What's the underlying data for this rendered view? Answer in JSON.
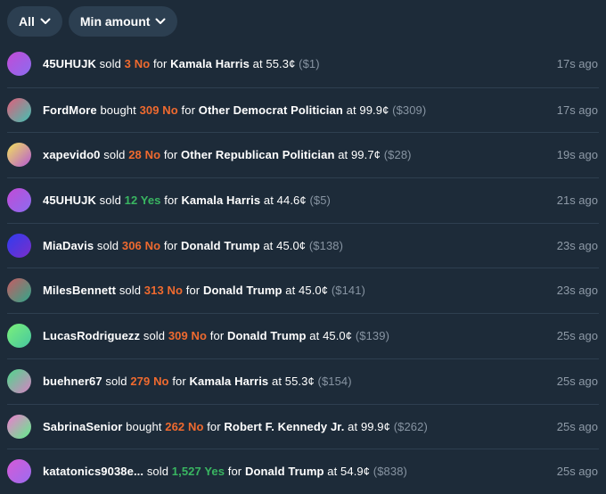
{
  "filters": {
    "all_label": "All",
    "min_amount_label": "Min amount"
  },
  "trades": [
    {
      "user": "45UHUJK",
      "verb": "sold",
      "amount": "3",
      "outcome": "No",
      "outcome_color": "#ef6a2f",
      "market": "Kamala Harris",
      "price": "55.3¢",
      "usd": "($1)",
      "time": "17s ago",
      "avatar_colors": [
        "#c24bd6",
        "#8a6cf0"
      ]
    },
    {
      "user": "FordMore",
      "verb": "bought",
      "amount": "309",
      "outcome": "No",
      "outcome_color": "#ef6a2f",
      "market": "Other Democrat Politician",
      "price": "99.9¢",
      "usd": "($309)",
      "time": "17s ago",
      "avatar_colors": [
        "#e35d7a",
        "#3fc2b3"
      ]
    },
    {
      "user": "xapevido0",
      "verb": "sold",
      "amount": "28",
      "outcome": "No",
      "outcome_color": "#ef6a2f",
      "market": "Other Republican Politician",
      "price": "99.7¢",
      "usd": "($28)",
      "time": "19s ago",
      "avatar_colors": [
        "#f2e35b",
        "#b65ad3"
      ]
    },
    {
      "user": "45UHUJK",
      "verb": "sold",
      "amount": "12",
      "outcome": "Yes",
      "outcome_color": "#39b561",
      "market": "Kamala Harris",
      "price": "44.6¢",
      "usd": "($5)",
      "time": "21s ago",
      "avatar_colors": [
        "#c24bd6",
        "#8a6cf0"
      ]
    },
    {
      "user": "MiaDavis",
      "verb": "sold",
      "amount": "306",
      "outcome": "No",
      "outcome_color": "#ef6a2f",
      "market": "Donald Trump",
      "price": "45.0¢",
      "usd": "($138)",
      "time": "23s ago",
      "avatar_colors": [
        "#2f3cf0",
        "#7b2ec9"
      ]
    },
    {
      "user": "MilesBennett",
      "verb": "sold",
      "amount": "313",
      "outcome": "No",
      "outcome_color": "#ef6a2f",
      "market": "Donald Trump",
      "price": "45.0¢",
      "usd": "($141)",
      "time": "23s ago",
      "avatar_colors": [
        "#c95a62",
        "#2ea88a"
      ]
    },
    {
      "user": "LucasRodriguezz",
      "verb": "sold",
      "amount": "309",
      "outcome": "No",
      "outcome_color": "#ef6a2f",
      "market": "Donald Trump",
      "price": "45.0¢",
      "usd": "($139)",
      "time": "25s ago",
      "avatar_colors": [
        "#7cf07a",
        "#46c7a0"
      ]
    },
    {
      "user": "buehner67",
      "verb": "sold",
      "amount": "279",
      "outcome": "No",
      "outcome_color": "#ef6a2f",
      "market": "Kamala Harris",
      "price": "55.3¢",
      "usd": "($154)",
      "time": "25s ago",
      "avatar_colors": [
        "#4cd88a",
        "#d782c4"
      ]
    },
    {
      "user": "SabrinaSenior",
      "verb": "bought",
      "amount": "262",
      "outcome": "No",
      "outcome_color": "#ef6a2f",
      "market": "Robert F. Kennedy Jr.",
      "price": "99.9¢",
      "usd": "($262)",
      "time": "25s ago",
      "avatar_colors": [
        "#f07ad0",
        "#5ef08a"
      ]
    },
    {
      "user": "katatonics9038e...",
      "verb": "sold",
      "amount": "1,527",
      "outcome": "Yes",
      "outcome_color": "#39b561",
      "market": "Donald Trump",
      "price": "54.9¢",
      "usd": "($838)",
      "time": "25s ago",
      "avatar_colors": [
        "#d65ad6",
        "#9b6cf0"
      ]
    }
  ]
}
